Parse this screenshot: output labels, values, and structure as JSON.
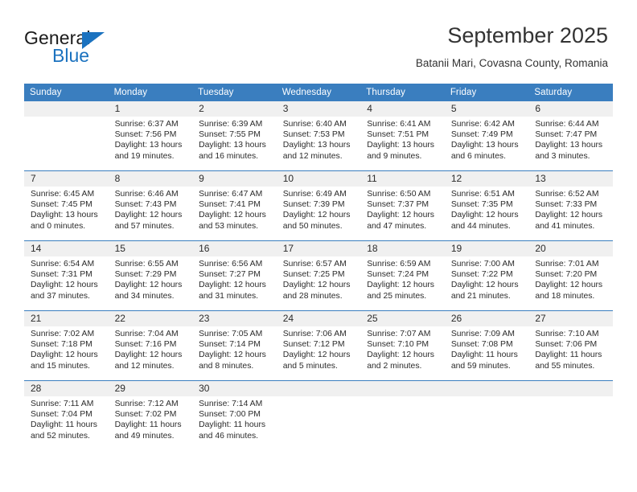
{
  "brand": {
    "name_top": "General",
    "name_bottom": "Blue",
    "accent_color": "#1b72bf",
    "triangle_icon": "triangle-icon"
  },
  "header": {
    "title": "September 2025",
    "subtitle": "Batanii Mari, Covasna County, Romania"
  },
  "calendar": {
    "header_background": "#3a7ebf",
    "header_text_color": "#ffffff",
    "daynum_background": "#f0f0f0",
    "weekday_headers": [
      "Sunday",
      "Monday",
      "Tuesday",
      "Wednesday",
      "Thursday",
      "Friday",
      "Saturday"
    ],
    "weeks": [
      [
        {
          "day": "",
          "sunrise": "",
          "sunset": "",
          "daylight_line1": "",
          "daylight_line2": ""
        },
        {
          "day": "1",
          "sunrise": "Sunrise: 6:37 AM",
          "sunset": "Sunset: 7:56 PM",
          "daylight_line1": "Daylight: 13 hours",
          "daylight_line2": "and 19 minutes."
        },
        {
          "day": "2",
          "sunrise": "Sunrise: 6:39 AM",
          "sunset": "Sunset: 7:55 PM",
          "daylight_line1": "Daylight: 13 hours",
          "daylight_line2": "and 16 minutes."
        },
        {
          "day": "3",
          "sunrise": "Sunrise: 6:40 AM",
          "sunset": "Sunset: 7:53 PM",
          "daylight_line1": "Daylight: 13 hours",
          "daylight_line2": "and 12 minutes."
        },
        {
          "day": "4",
          "sunrise": "Sunrise: 6:41 AM",
          "sunset": "Sunset: 7:51 PM",
          "daylight_line1": "Daylight: 13 hours",
          "daylight_line2": "and 9 minutes."
        },
        {
          "day": "5",
          "sunrise": "Sunrise: 6:42 AM",
          "sunset": "Sunset: 7:49 PM",
          "daylight_line1": "Daylight: 13 hours",
          "daylight_line2": "and 6 minutes."
        },
        {
          "day": "6",
          "sunrise": "Sunrise: 6:44 AM",
          "sunset": "Sunset: 7:47 PM",
          "daylight_line1": "Daylight: 13 hours",
          "daylight_line2": "and 3 minutes."
        }
      ],
      [
        {
          "day": "7",
          "sunrise": "Sunrise: 6:45 AM",
          "sunset": "Sunset: 7:45 PM",
          "daylight_line1": "Daylight: 13 hours",
          "daylight_line2": "and 0 minutes."
        },
        {
          "day": "8",
          "sunrise": "Sunrise: 6:46 AM",
          "sunset": "Sunset: 7:43 PM",
          "daylight_line1": "Daylight: 12 hours",
          "daylight_line2": "and 57 minutes."
        },
        {
          "day": "9",
          "sunrise": "Sunrise: 6:47 AM",
          "sunset": "Sunset: 7:41 PM",
          "daylight_line1": "Daylight: 12 hours",
          "daylight_line2": "and 53 minutes."
        },
        {
          "day": "10",
          "sunrise": "Sunrise: 6:49 AM",
          "sunset": "Sunset: 7:39 PM",
          "daylight_line1": "Daylight: 12 hours",
          "daylight_line2": "and 50 minutes."
        },
        {
          "day": "11",
          "sunrise": "Sunrise: 6:50 AM",
          "sunset": "Sunset: 7:37 PM",
          "daylight_line1": "Daylight: 12 hours",
          "daylight_line2": "and 47 minutes."
        },
        {
          "day": "12",
          "sunrise": "Sunrise: 6:51 AM",
          "sunset": "Sunset: 7:35 PM",
          "daylight_line1": "Daylight: 12 hours",
          "daylight_line2": "and 44 minutes."
        },
        {
          "day": "13",
          "sunrise": "Sunrise: 6:52 AM",
          "sunset": "Sunset: 7:33 PM",
          "daylight_line1": "Daylight: 12 hours",
          "daylight_line2": "and 41 minutes."
        }
      ],
      [
        {
          "day": "14",
          "sunrise": "Sunrise: 6:54 AM",
          "sunset": "Sunset: 7:31 PM",
          "daylight_line1": "Daylight: 12 hours",
          "daylight_line2": "and 37 minutes."
        },
        {
          "day": "15",
          "sunrise": "Sunrise: 6:55 AM",
          "sunset": "Sunset: 7:29 PM",
          "daylight_line1": "Daylight: 12 hours",
          "daylight_line2": "and 34 minutes."
        },
        {
          "day": "16",
          "sunrise": "Sunrise: 6:56 AM",
          "sunset": "Sunset: 7:27 PM",
          "daylight_line1": "Daylight: 12 hours",
          "daylight_line2": "and 31 minutes."
        },
        {
          "day": "17",
          "sunrise": "Sunrise: 6:57 AM",
          "sunset": "Sunset: 7:25 PM",
          "daylight_line1": "Daylight: 12 hours",
          "daylight_line2": "and 28 minutes."
        },
        {
          "day": "18",
          "sunrise": "Sunrise: 6:59 AM",
          "sunset": "Sunset: 7:24 PM",
          "daylight_line1": "Daylight: 12 hours",
          "daylight_line2": "and 25 minutes."
        },
        {
          "day": "19",
          "sunrise": "Sunrise: 7:00 AM",
          "sunset": "Sunset: 7:22 PM",
          "daylight_line1": "Daylight: 12 hours",
          "daylight_line2": "and 21 minutes."
        },
        {
          "day": "20",
          "sunrise": "Sunrise: 7:01 AM",
          "sunset": "Sunset: 7:20 PM",
          "daylight_line1": "Daylight: 12 hours",
          "daylight_line2": "and 18 minutes."
        }
      ],
      [
        {
          "day": "21",
          "sunrise": "Sunrise: 7:02 AM",
          "sunset": "Sunset: 7:18 PM",
          "daylight_line1": "Daylight: 12 hours",
          "daylight_line2": "and 15 minutes."
        },
        {
          "day": "22",
          "sunrise": "Sunrise: 7:04 AM",
          "sunset": "Sunset: 7:16 PM",
          "daylight_line1": "Daylight: 12 hours",
          "daylight_line2": "and 12 minutes."
        },
        {
          "day": "23",
          "sunrise": "Sunrise: 7:05 AM",
          "sunset": "Sunset: 7:14 PM",
          "daylight_line1": "Daylight: 12 hours",
          "daylight_line2": "and 8 minutes."
        },
        {
          "day": "24",
          "sunrise": "Sunrise: 7:06 AM",
          "sunset": "Sunset: 7:12 PM",
          "daylight_line1": "Daylight: 12 hours",
          "daylight_line2": "and 5 minutes."
        },
        {
          "day": "25",
          "sunrise": "Sunrise: 7:07 AM",
          "sunset": "Sunset: 7:10 PM",
          "daylight_line1": "Daylight: 12 hours",
          "daylight_line2": "and 2 minutes."
        },
        {
          "day": "26",
          "sunrise": "Sunrise: 7:09 AM",
          "sunset": "Sunset: 7:08 PM",
          "daylight_line1": "Daylight: 11 hours",
          "daylight_line2": "and 59 minutes."
        },
        {
          "day": "27",
          "sunrise": "Sunrise: 7:10 AM",
          "sunset": "Sunset: 7:06 PM",
          "daylight_line1": "Daylight: 11 hours",
          "daylight_line2": "and 55 minutes."
        }
      ],
      [
        {
          "day": "28",
          "sunrise": "Sunrise: 7:11 AM",
          "sunset": "Sunset: 7:04 PM",
          "daylight_line1": "Daylight: 11 hours",
          "daylight_line2": "and 52 minutes."
        },
        {
          "day": "29",
          "sunrise": "Sunrise: 7:12 AM",
          "sunset": "Sunset: 7:02 PM",
          "daylight_line1": "Daylight: 11 hours",
          "daylight_line2": "and 49 minutes."
        },
        {
          "day": "30",
          "sunrise": "Sunrise: 7:14 AM",
          "sunset": "Sunset: 7:00 PM",
          "daylight_line1": "Daylight: 11 hours",
          "daylight_line2": "and 46 minutes."
        },
        {
          "day": "",
          "sunrise": "",
          "sunset": "",
          "daylight_line1": "",
          "daylight_line2": ""
        },
        {
          "day": "",
          "sunrise": "",
          "sunset": "",
          "daylight_line1": "",
          "daylight_line2": ""
        },
        {
          "day": "",
          "sunrise": "",
          "sunset": "",
          "daylight_line1": "",
          "daylight_line2": ""
        },
        {
          "day": "",
          "sunrise": "",
          "sunset": "",
          "daylight_line1": "",
          "daylight_line2": ""
        }
      ]
    ]
  }
}
